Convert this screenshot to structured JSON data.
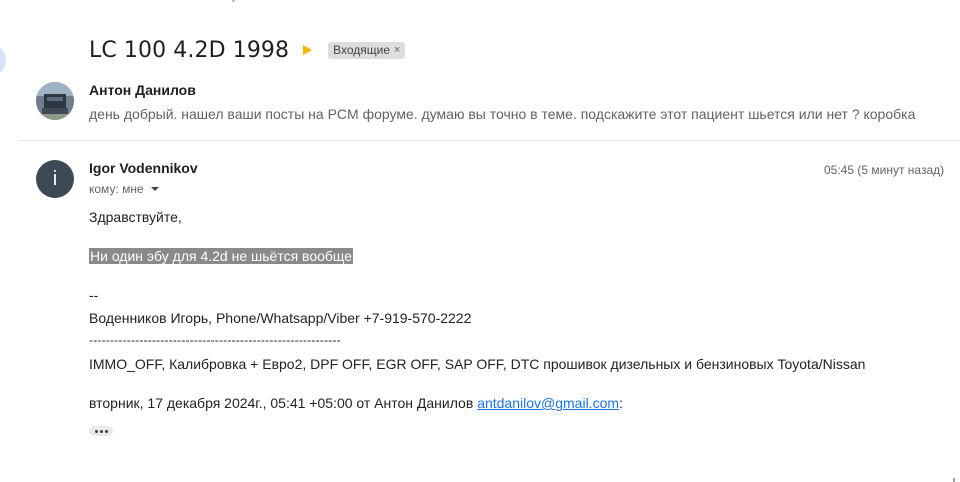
{
  "thread": {
    "subject": "LC 100 4.2D 1998",
    "label": "Входящие",
    "label_close": "×"
  },
  "collapsed_message": {
    "sender": "Антон Данилов",
    "snippet": "день добрый. нашел ваши посты на PCM форуме. думаю вы точно в теме. подскажите этот пациент шьется или нет ? коробка"
  },
  "open_message": {
    "avatar_letter": "i",
    "sender": "Igor Vodennikov",
    "recipient": "кому: мне",
    "time": "05:45 (5 минут назад)",
    "greeting": "Здравствуйте,",
    "highlighted": "Ни один эбу для 4.2d не шьётся вообще",
    "sig_dashes": "--",
    "sig_contact": "Воденников Игорь, Phone/Whatsapp/Viber +7-919-570-2222",
    "sig_separator": "------------------------------------------------------------",
    "sig_services": "IMMO_OFF, Калибровка + Евро2, DPF OFF, EGR OFF, SAP OFF, DTC прошивок дизельных и бензиновых Toyota/Nissan",
    "quote_intro": "вторник, 17 декабря 2024г., 05:41 +05:00 от Антон Данилов",
    "quote_email": "antdanilov@gmail.com",
    "quote_colon": ":"
  },
  "colors": {
    "importance": "#f4b400",
    "avatar_dark": "#3c4a55",
    "link": "#1a73e8",
    "highlight_bg": "#8a8a8a"
  },
  "icons": [
    "importance-marker-icon",
    "chevron-down-icon",
    "more-dots-icon"
  ]
}
